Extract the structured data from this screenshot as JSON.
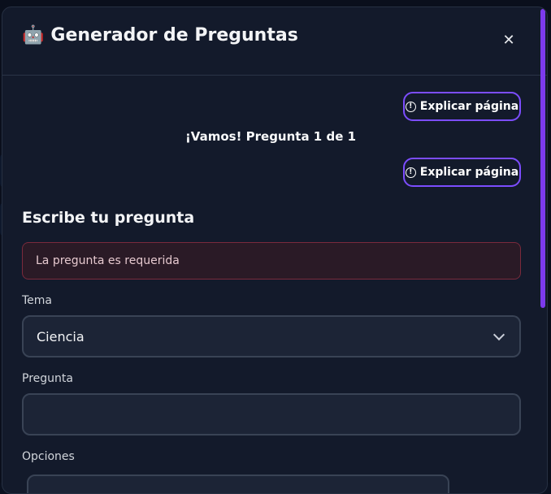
{
  "modal": {
    "title": "Generador de Preguntas",
    "title_icon": "🤖",
    "close_symbol": "✕"
  },
  "explain_button": {
    "label": "Explicar página",
    "icon": "info-icon"
  },
  "progress_text": "¡Vamos! Pregunta 1 de 1",
  "form": {
    "section_title": "Escribe tu pregunta",
    "error_message": "La pregunta es requerida",
    "topic_label": "Tema",
    "topic_value": "Ciencia",
    "question_label": "Pregunta",
    "question_value": "",
    "options_label": "Opciones"
  },
  "colors": {
    "accent": "#7c4dff",
    "background": "#131a2b",
    "error_border": "#7a2a3c"
  }
}
